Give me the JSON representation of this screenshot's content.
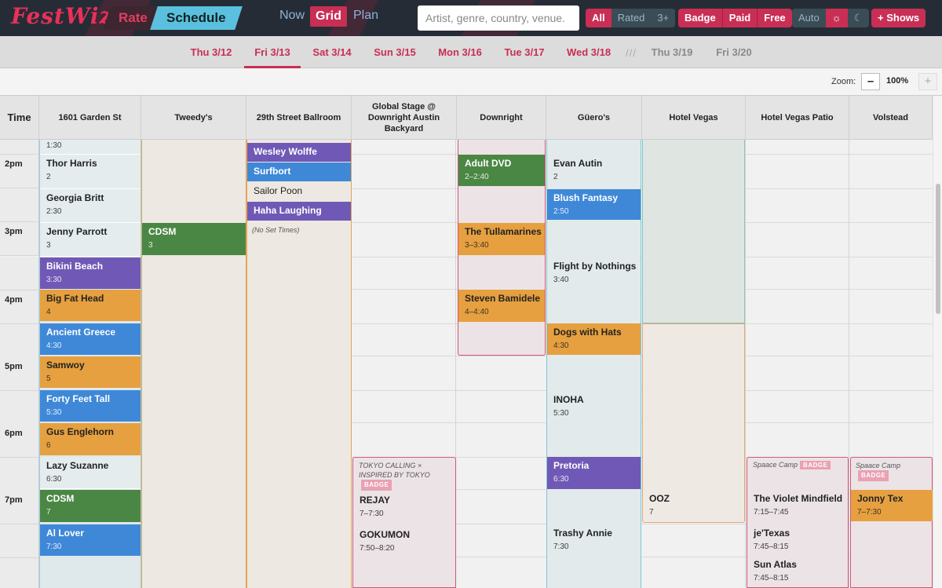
{
  "app": {
    "logo": "FestWiz",
    "modes": {
      "rate": "Rate",
      "schedule": "Schedule"
    },
    "views": {
      "now": "Now",
      "grid": "Grid",
      "plan": "Plan"
    },
    "search": {
      "placeholder": "Artist, genre, country, venue.",
      "value": ""
    },
    "rating_filter": [
      "All",
      "Rated",
      "3+"
    ],
    "access_filter": [
      "Badge",
      "Paid",
      "Free"
    ],
    "theme": {
      "auto": "Auto",
      "light_icon": "sun-icon",
      "dark_icon": "moon-icon"
    },
    "add_shows": "+ Shows",
    "colors": {
      "accent": "#c92e55",
      "header": "#262c35",
      "schedule_tab": "#5bc0de"
    }
  },
  "days": {
    "items": [
      "Thu 3/12",
      "Fri 3/13",
      "Sat 3/14",
      "Sun 3/15",
      "Mon 3/16",
      "Tue 3/17",
      "Wed 3/18",
      "Thu 3/19",
      "Fri 3/20"
    ],
    "selected": "Fri 3/13",
    "separator": "///"
  },
  "zoom": {
    "label": "Zoom:",
    "value": "100%",
    "minus": "–",
    "plus": "+"
  },
  "grid": {
    "time_header": "Time",
    "time_labels": [
      "2pm",
      "3pm",
      "4pm",
      "5pm",
      "6pm",
      "7pm"
    ],
    "venues": [
      "1601 Garden St",
      "Tweedy's",
      "29th Street Ballroom",
      "Global Stage @ Downright Austin Backyard",
      "Downright",
      "Güero's",
      "Hotel Vegas",
      "Hotel Vegas Patio",
      "Volstead"
    ],
    "acts": {
      "garden": [
        {
          "name": "",
          "time": "1:30"
        },
        {
          "name": "Thor Harris",
          "time": "2"
        },
        {
          "name": "Georgia Britt",
          "time": "2:30"
        },
        {
          "name": "Jenny Parrott",
          "time": "3"
        },
        {
          "name": "Bikini Beach",
          "time": "3:30"
        },
        {
          "name": "Big Fat Head",
          "time": "4"
        },
        {
          "name": "Ancient Greece",
          "time": "4:30"
        },
        {
          "name": "Samwoy",
          "time": "5"
        },
        {
          "name": "Forty Feet Tall",
          "time": "5:30"
        },
        {
          "name": "Gus Englehorn",
          "time": "6"
        },
        {
          "name": "Lazy Suzanne",
          "time": "6:30"
        },
        {
          "name": "CDSM",
          "time": "7"
        },
        {
          "name": "Al Lover",
          "time": "7:30"
        }
      ],
      "tweedys": [
        {
          "name": "CDSM",
          "time": "3"
        }
      ],
      "ballroom": [
        {
          "name": "Wesley Wolffe"
        },
        {
          "name": "Surfbort"
        },
        {
          "name": "Sailor Poon"
        },
        {
          "name": "Haha Laughing"
        }
      ],
      "ballroom_note": "(No Set Times)",
      "global_event": "TOKYO CALLING × INSPIRED BY TOKYO",
      "global": [
        {
          "name": "REJAY",
          "time": "7–7:30"
        },
        {
          "name": "GOKUMON",
          "time": "7:50–8:20"
        }
      ],
      "downright": [
        {
          "name": "Adult DVD",
          "time": "2–2:40"
        },
        {
          "name": "The Tullamarines",
          "time": "3–3:40"
        },
        {
          "name": "Steven Bamidele",
          "time": "4–4:40"
        }
      ],
      "gueros": [
        {
          "name": "Evan Autin",
          "time": "2"
        },
        {
          "name": "Blush Fantasy",
          "time": "2:50"
        },
        {
          "name": "Flight by Nothings",
          "time": "3:40"
        },
        {
          "name": "Dogs with Hats",
          "time": "4:30"
        },
        {
          "name": "INOHA",
          "time": "5:30"
        },
        {
          "name": "Pretoria",
          "time": "6:30"
        },
        {
          "name": "Trashy Annie",
          "time": "7:30"
        }
      ],
      "vegas": [
        {
          "name": "OOZ",
          "time": "7"
        }
      ],
      "patio_event": "Spaace Camp",
      "patio": [
        {
          "name": "The Violet Mindfield",
          "time": "7:15–7:45"
        },
        {
          "name": "je'Texas",
          "time": "7:45–8:15"
        },
        {
          "name": "Sun Atlas",
          "time": "7:45–8:15"
        }
      ],
      "volstead_event": "Spaace Camp",
      "volstead": [
        {
          "name": "Jonny Tex",
          "time": "7–7:30"
        }
      ]
    },
    "badge_label": "BADGE"
  }
}
